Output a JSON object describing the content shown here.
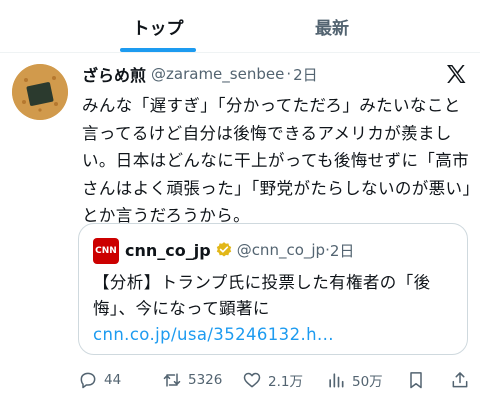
{
  "tabs": {
    "top": "トップ",
    "latest": "最新"
  },
  "tweet": {
    "display_name": "ざらめ煎",
    "handle": "@zarame_senbee",
    "separator": "·",
    "time": "2日",
    "text": "みんな「遅すぎ」「分かってただろ」みたいなこと言ってるけど自分は後悔できるアメリカが羨ましい。日本はどんなに干上がっても後悔せずに「高市さんはよく頑張った」「野党がたらしないのが悪い」とか言うだろうから。"
  },
  "quote": {
    "avatar_text": "CNN",
    "display_name": "cnn_co_jp",
    "handle": "@cnn_co_jp",
    "separator": "·",
    "time": "2日",
    "text": "【分析】トランプ氏に投票した有権者の「後悔」、今になって顕著に",
    "link": "cnn.co.jp/usa/35246132.h..."
  },
  "actions": {
    "replies": "44",
    "retweets": "5326",
    "likes": "2.1万",
    "views": "50万"
  },
  "icons": {
    "x_logo": "x-logo-icon",
    "verified": "verified-badge-icon",
    "reply": "reply-icon",
    "retweet": "retweet-icon",
    "like": "heart-icon",
    "views": "views-icon",
    "bookmark": "bookmark-icon",
    "share": "share-icon"
  },
  "colors": {
    "accent": "#1d9bf0",
    "text": "#0f1419",
    "secondary": "#536471",
    "verified": "#e2b719",
    "cnn_red": "#cc0000"
  }
}
